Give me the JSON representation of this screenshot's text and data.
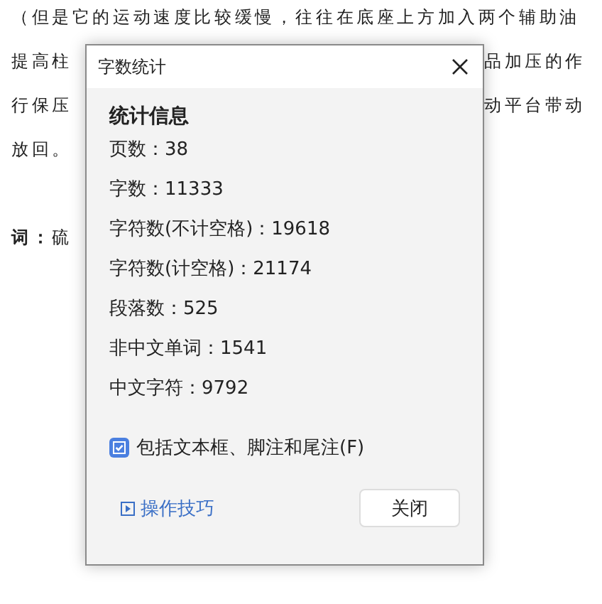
{
  "document": {
    "lines": [
      {
        "left": "（但是它的运动速度比较缓慢，往往在底座上方加入两个辅助油"
      },
      {
        "left": "提高柱",
        "right": "品加压的作"
      },
      {
        "left": "行保压",
        "right": "动平台带动"
      },
      {
        "left": "放回。"
      },
      {
        "left": "**词：**硫"
      }
    ]
  },
  "dialog": {
    "title": "字数统计",
    "section_title": "统计信息",
    "stats": [
      "页数：38",
      "字数：11333",
      "字符数(不计空格)：19618",
      "字符数(计空格)：21174",
      "段落数：525",
      "非中文单词：1541",
      "中文字符：9792"
    ],
    "checkbox": {
      "label": "包括文本框、脚注和尾注(F)",
      "checked": true
    },
    "tips_link": "操作技巧",
    "close_button": "关闭"
  }
}
